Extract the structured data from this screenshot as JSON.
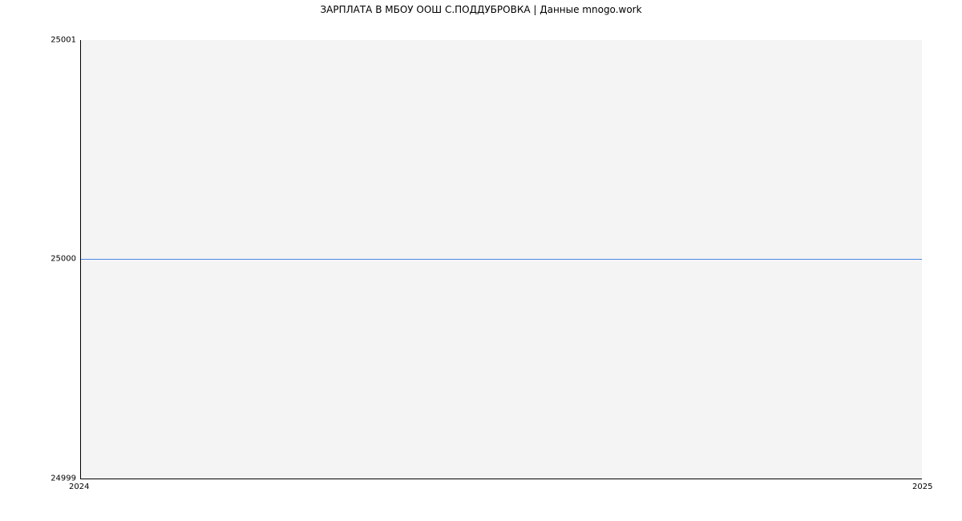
{
  "chart_data": {
    "type": "line",
    "title": "ЗАРПЛАТА В МБОУ ООШ С.ПОДДУБРОВКА | Данные mnogo.work",
    "x": [
      "2024",
      "2025"
    ],
    "values": [
      25000,
      25000
    ],
    "y_ticks": [
      "25001",
      "25000",
      "24999"
    ],
    "x_ticks": [
      "2024",
      "2025"
    ],
    "xlabel": "",
    "ylabel": "",
    "ylim": [
      24999,
      25001
    ]
  }
}
